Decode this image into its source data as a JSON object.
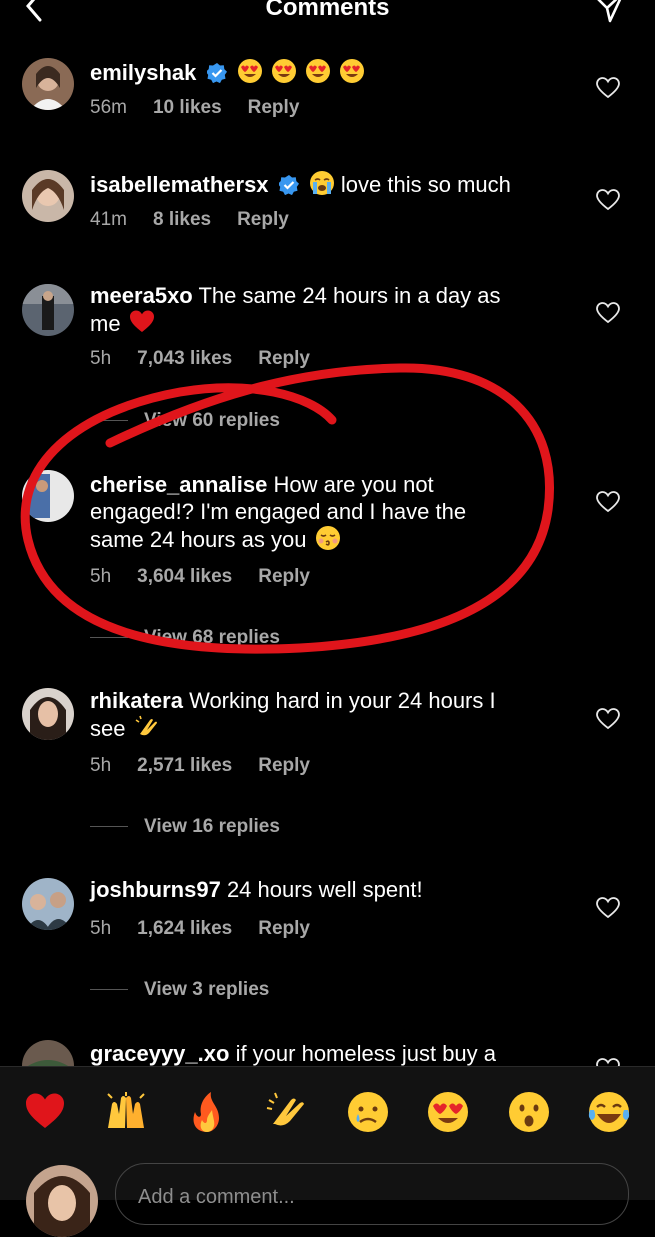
{
  "header": {
    "title": "Comments"
  },
  "comments": [
    {
      "username": "emilyshak",
      "verified": true,
      "text": "",
      "time": "56m",
      "likes": "10 likes",
      "reply": "Reply"
    },
    {
      "username": "isabellemathersx",
      "verified": true,
      "text": "love this so much",
      "time": "41m",
      "likes": "8 likes",
      "reply": "Reply"
    },
    {
      "username": "meera5xo",
      "text_line1": "The same 24 hours in a day as",
      "text_line2": "me",
      "time": "5h",
      "likes": "7,043 likes",
      "reply": "Reply",
      "view_replies": "View 60 replies"
    },
    {
      "username": "cherise_annalise",
      "text_line1": "How are you not",
      "text_line2": "engaged!? I'm engaged and I have the",
      "text_line3": "same 24 hours as you",
      "time": "5h",
      "likes": "3,604 likes",
      "reply": "Reply",
      "view_replies": "View 68 replies"
    },
    {
      "username": "rhikatera",
      "text_line1": "Working hard in your 24 hours I",
      "text_line2": "see",
      "time": "5h",
      "likes": "2,571 likes",
      "reply": "Reply",
      "view_replies": "View 16 replies"
    },
    {
      "username": "joshburns97",
      "text": "24 hours well spent!",
      "time": "5h",
      "likes": "1,624 likes",
      "reply": "Reply",
      "view_replies": "View 3 replies"
    },
    {
      "username": "graceyyy_.xo",
      "text": "if your homeless just buy a"
    }
  ],
  "composer": {
    "placeholder": "Add a comment..."
  },
  "reactions": [
    "red-heart",
    "raising-hands",
    "fire",
    "clapping-hands",
    "crying-face",
    "heart-eyes",
    "surprised-face",
    "tears-of-joy"
  ],
  "colors": {
    "accent_red": "#e0151b",
    "verified_blue": "#3897f0",
    "muted": "#a8a8a8"
  }
}
